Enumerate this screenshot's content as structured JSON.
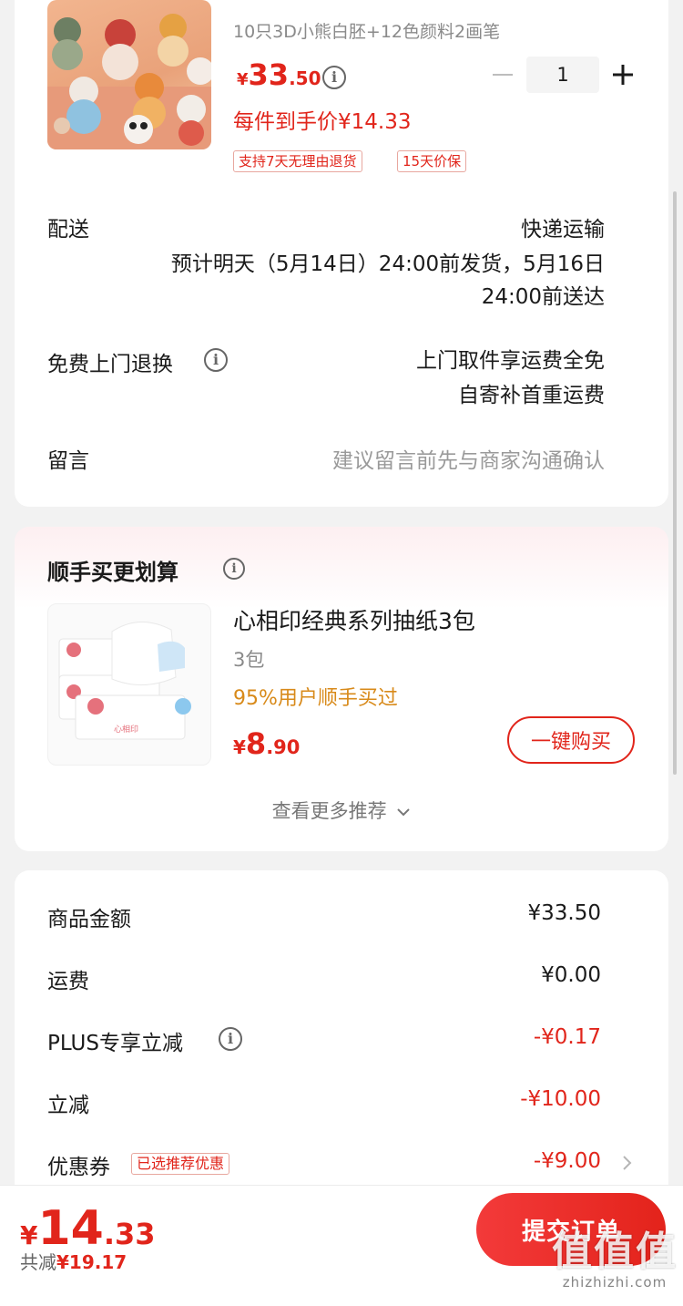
{
  "product": {
    "spec": "10只3D小熊白胚+12色颜料2画笔",
    "price_symbol": "¥",
    "price_int": "33",
    "price_dec": ".50",
    "quantity": "1",
    "per_item_price": "每件到手价¥14.33",
    "tags": [
      "支持7天无理由退货",
      "15天价保"
    ]
  },
  "delivery": {
    "label": "配送",
    "method": "快递运输",
    "eta_line1": "预计明天（5月14日）24:00前发货，5月16日",
    "eta_line2": "24:00前送达"
  },
  "return_service": {
    "label": "免费上门退换",
    "line1": "上门取件享运费全免",
    "line2": "自寄补首重运费"
  },
  "message": {
    "label": "留言",
    "placeholder": "建议留言前先与商家沟通确认"
  },
  "addon": {
    "section_title": "顺手买更划算",
    "product_name": "心相印经典系列抽纸3包",
    "spec": "3包",
    "social_proof": "95%用户顺手买过",
    "price_symbol": "¥",
    "price_int": "8",
    "price_dec": ".90",
    "buy_button": "一键购买",
    "more_link": "查看更多推荐"
  },
  "summary": {
    "rows": [
      {
        "label": "商品金额",
        "value": "¥33.50"
      },
      {
        "label": "运费",
        "value": "¥0.00"
      },
      {
        "label": "PLUS专享立减",
        "value": "-¥0.17"
      },
      {
        "label": "立减",
        "value": "-¥10.00"
      },
      {
        "label": "优惠券",
        "value": "-¥9.00",
        "badge": "已选推荐优惠"
      }
    ]
  },
  "footer": {
    "total_symbol": "¥",
    "total_int": "14",
    "total_dec": ".33",
    "saved_label": "共减",
    "saved_value": "¥19.17",
    "submit_label": "提交订单"
  },
  "watermark": {
    "glyphs": "值值值",
    "site": "zhizhizhi.com"
  },
  "colors": {
    "accent": "#e1251b",
    "social_proof": "#d88a1a",
    "background": "#f2f2f2"
  }
}
